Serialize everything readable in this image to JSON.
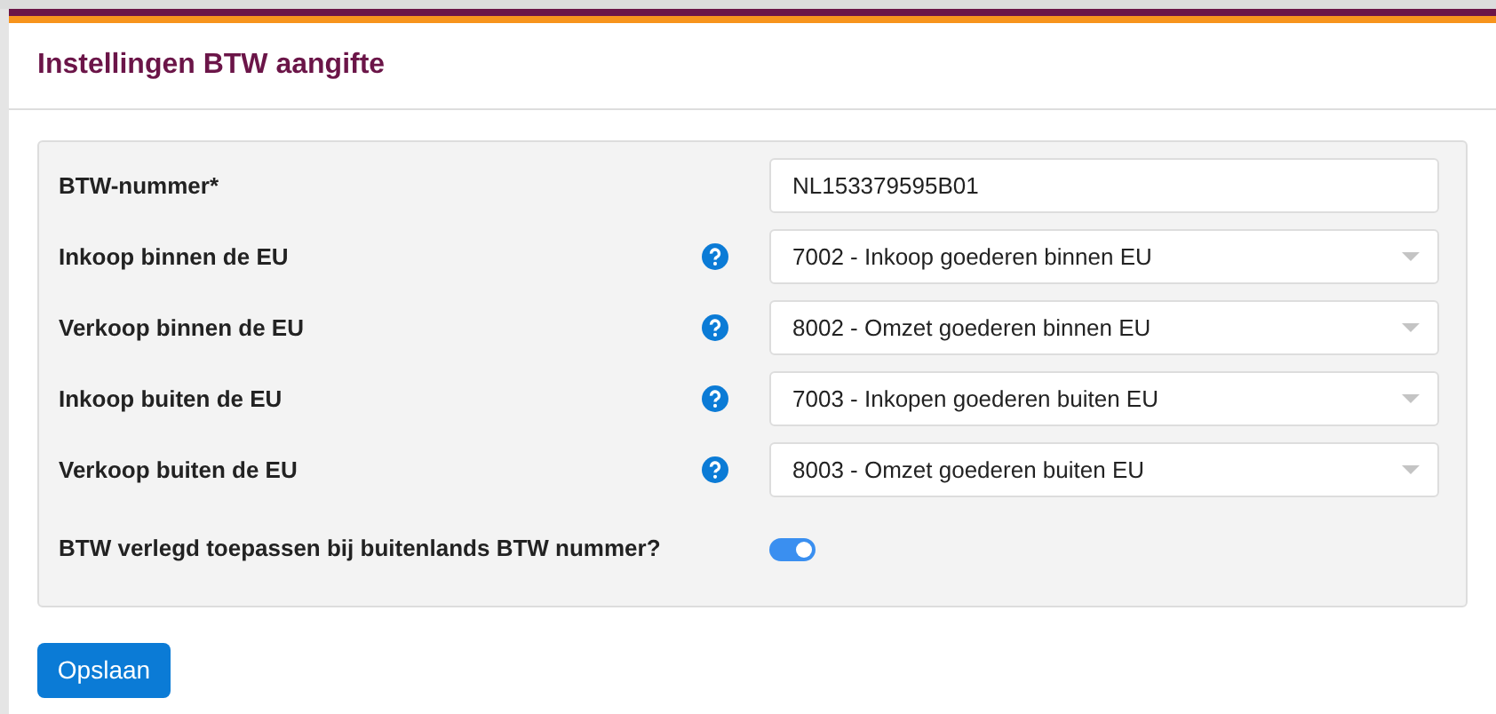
{
  "title": "Instellingen BTW aangifte",
  "fields": [
    {
      "kind": "text",
      "label": "BTW-nummer*",
      "help": false,
      "value": "NL153379595B01"
    },
    {
      "kind": "select",
      "label": "Inkoop binnen de EU",
      "help": true,
      "value": "7002 - Inkoop goederen binnen EU"
    },
    {
      "kind": "select",
      "label": "Verkoop binnen de EU",
      "help": true,
      "value": "8002 - Omzet goederen binnen EU"
    },
    {
      "kind": "select",
      "label": "Inkoop buiten de EU",
      "help": true,
      "value": "7003 - Inkopen goederen buiten EU"
    },
    {
      "kind": "select",
      "label": "Verkoop buiten de EU",
      "help": true,
      "value": "8003 - Omzet goederen buiten EU"
    },
    {
      "kind": "toggle",
      "label": "BTW verlegd toepassen bij buitenlands BTW nummer?",
      "on": true
    }
  ],
  "save_button": "Opslaan"
}
